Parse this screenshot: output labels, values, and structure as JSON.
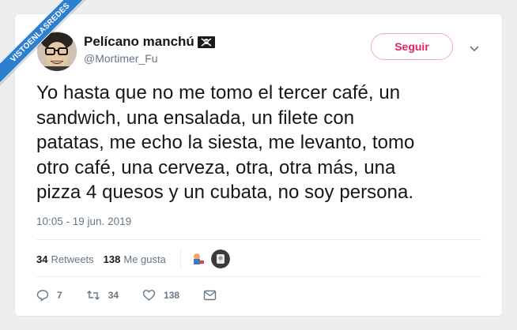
{
  "watermark": {
    "text": "VISTOENLASREDES",
    "color": "#2f7fd0"
  },
  "user": {
    "name": "Pelícano manchú",
    "name_emoji": "skull-and-crossbones-flag-icon",
    "handle": "@Mortimer_Fu"
  },
  "follow_button": {
    "label": "Seguir",
    "color": "#e0245e"
  },
  "tweet": {
    "lines": [
      "Yo hasta que no me tomo el tercer café, un",
      "sandwich, una ensalada, un filete con",
      "patatas, me echo la siesta, me levanto, tomo",
      "otro café, una cerveza, otra, otra más, una",
      "pizza 4 quesos y un cubata, no soy persona."
    ],
    "timestamp": "10:05 - 19 jun. 2019"
  },
  "stats": {
    "retweets_count": "34",
    "retweets_label": "Retweets",
    "likes_count": "138",
    "likes_label": "Me gusta"
  },
  "actions": {
    "replies": "7",
    "retweets": "34",
    "likes": "138"
  }
}
